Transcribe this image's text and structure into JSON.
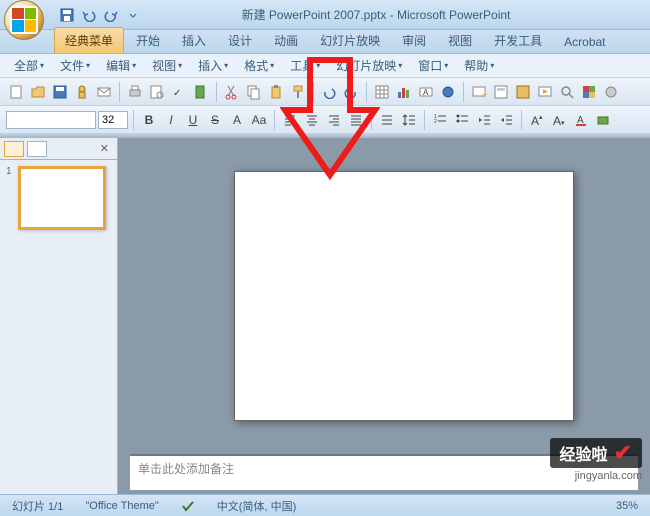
{
  "title": "新建 PowerPoint 2007.pptx - Microsoft PowerPoint",
  "ribbon_tabs": {
    "classic": "经典菜单",
    "home": "开始",
    "insert": "插入",
    "design": "设计",
    "animation": "动画",
    "slideshow": "幻灯片放映",
    "review": "审阅",
    "view": "视图",
    "developer": "开发工具",
    "acrobat": "Acrobat"
  },
  "menus": {
    "all": "全部",
    "file": "文件",
    "edit": "编辑",
    "view": "视图",
    "insert": "插入",
    "format": "格式",
    "tools": "工具",
    "slideshow": "幻灯片放映",
    "window": "窗口",
    "help": "帮助"
  },
  "toolbar": {
    "font_size": "32",
    "bold": "B",
    "italic": "I",
    "underline": "U",
    "strike": "S",
    "textfx": "A",
    "textfx2": "Aa"
  },
  "slide_panel": {
    "close": "✕",
    "slides": [
      {
        "number": "1"
      }
    ]
  },
  "notes_placeholder": "单击此处添加备注",
  "status": {
    "slide_info": "幻灯片 1/1",
    "theme": "\"Office Theme\"",
    "lang": "中文(简体, 中国)",
    "zoom": "35%"
  },
  "watermark": {
    "brand": "经验啦",
    "url": "jingyanla.com"
  }
}
